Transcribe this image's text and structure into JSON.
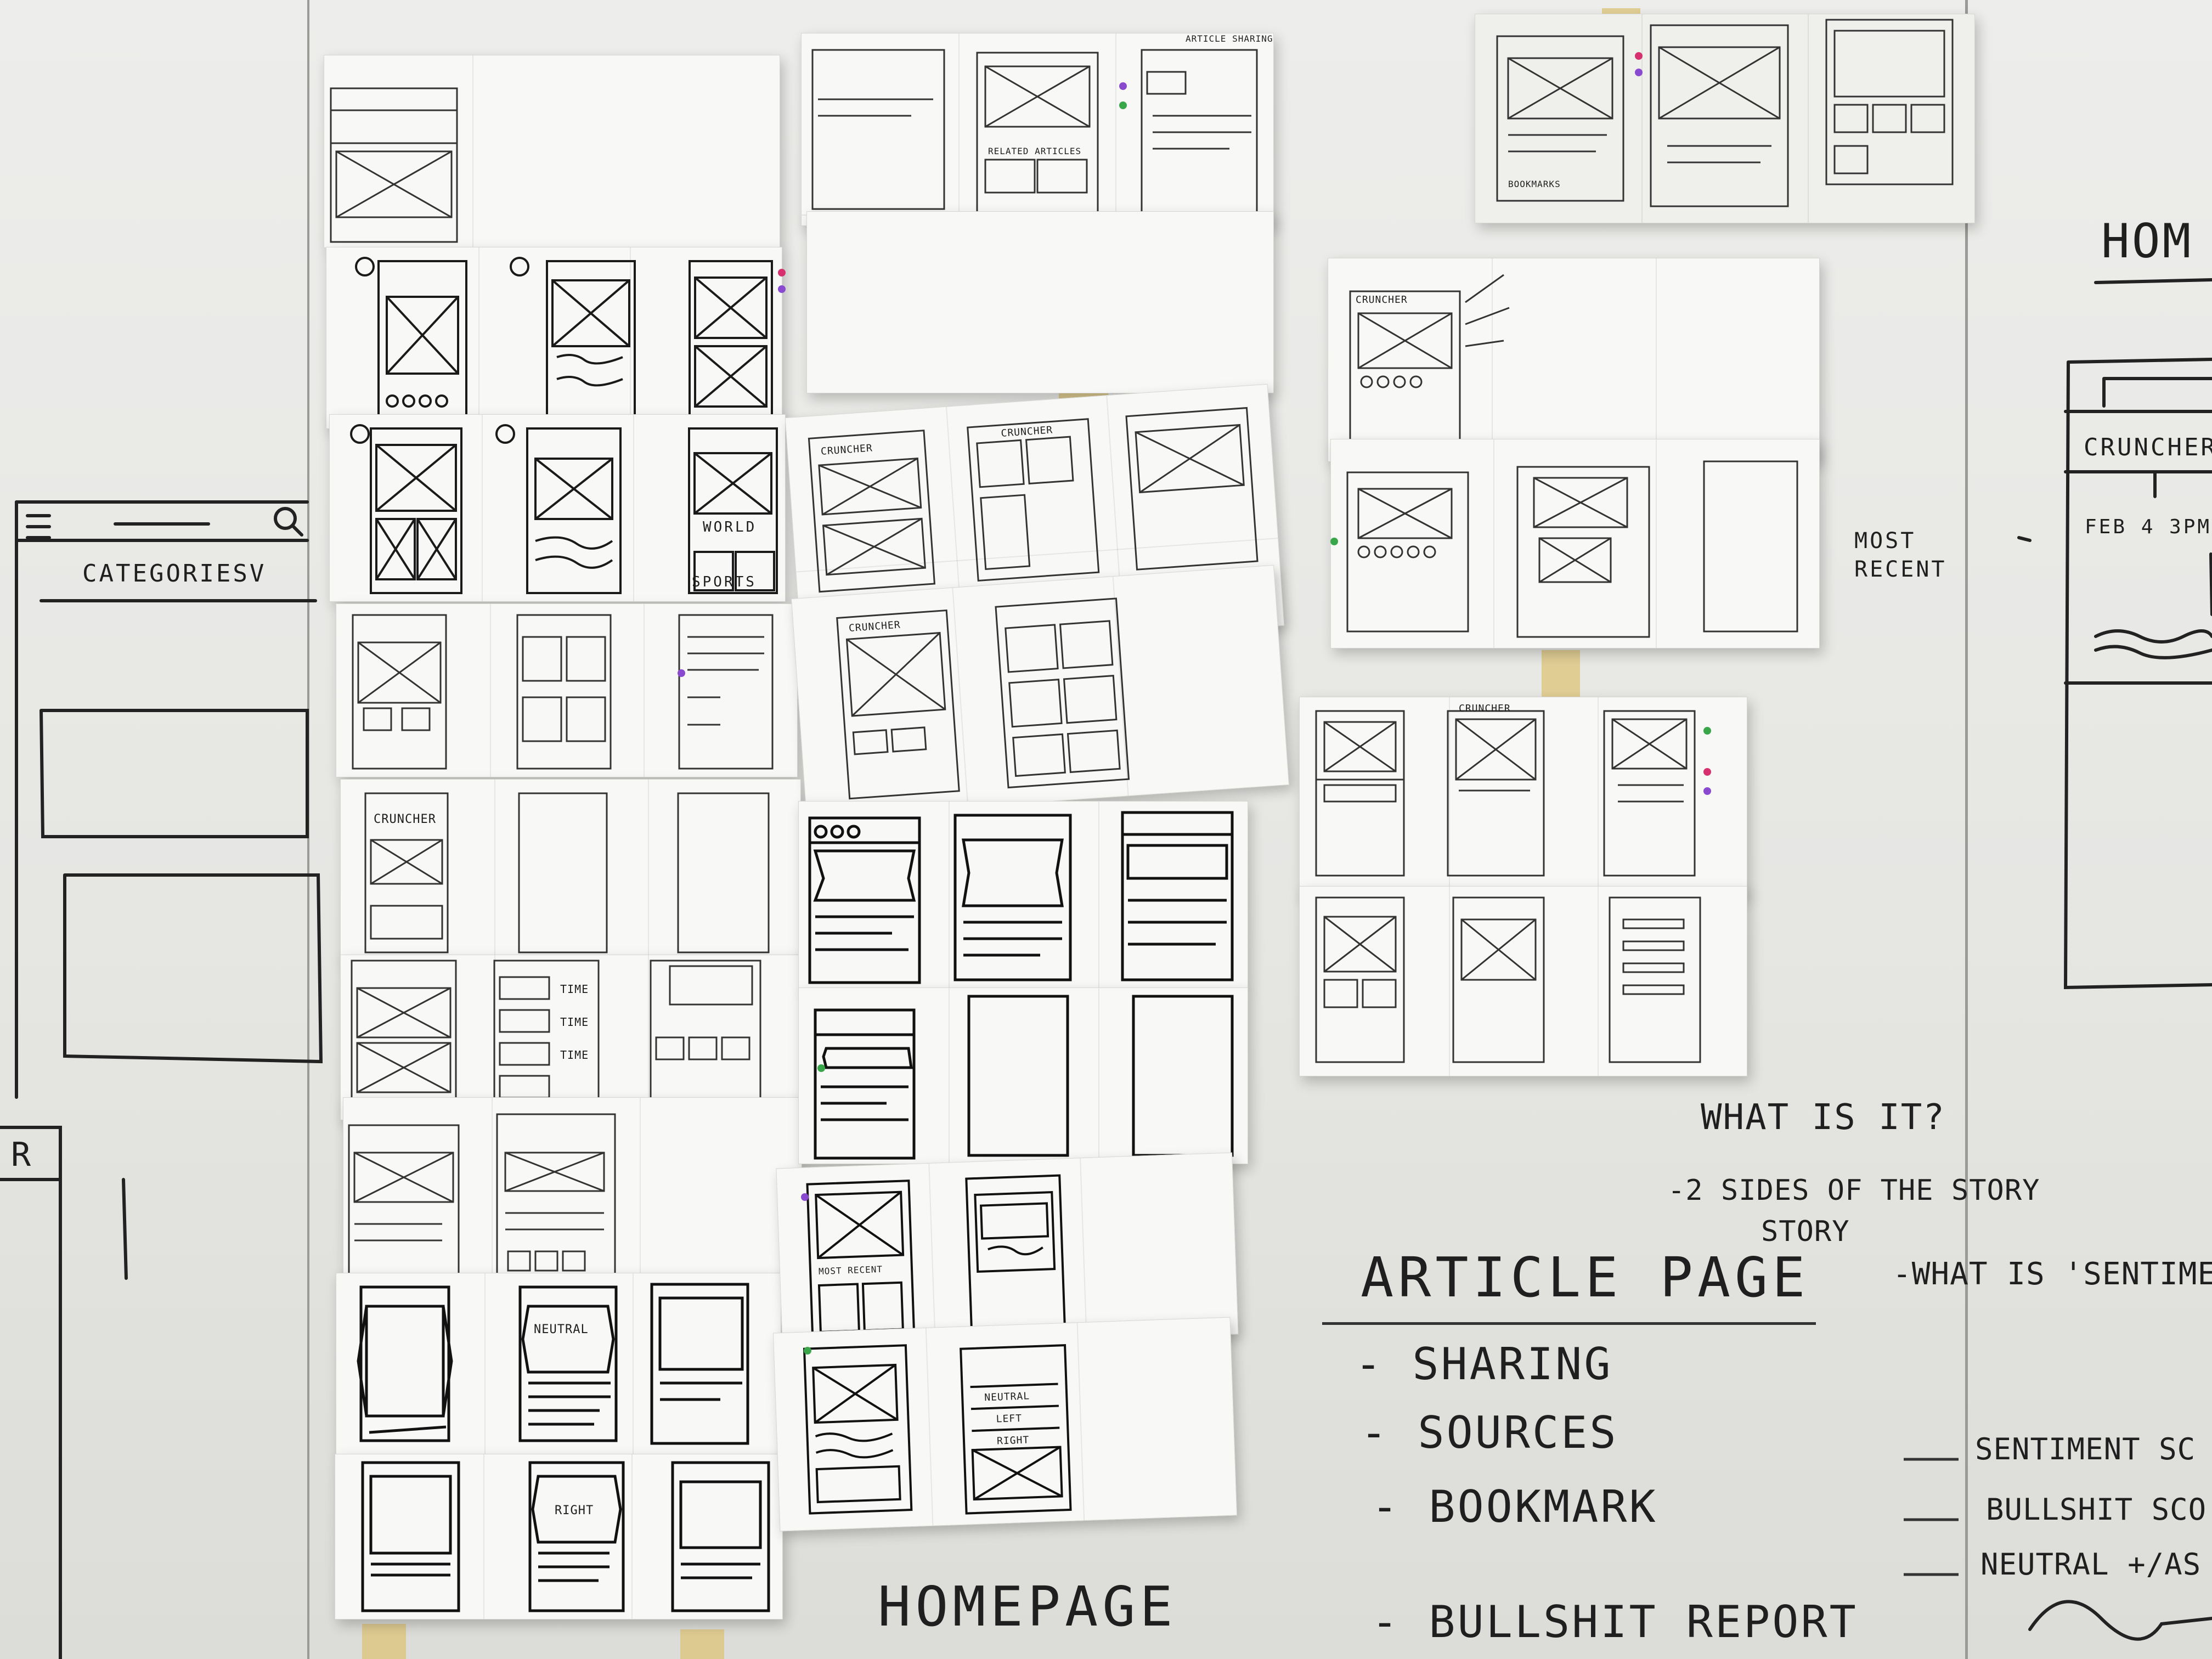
{
  "whiteboard": {
    "left": {
      "categories": "CATEGORIESV",
      "mock_r": "R"
    },
    "right": {
      "homepage_heading": "HOM",
      "cruncher": "CRUNCHER",
      "date": "FEB 4 3PM",
      "most_recent": "MOST RECENT"
    },
    "notes": {
      "what_is_it": "WHAT IS IT?",
      "two_sides": "-2 SIDES OF THE STORY",
      "what_is_sentiment": "-WHAT IS 'SENTIME",
      "article_page": "ARTICLE PAGE",
      "items": [
        "- SHARING",
        "- SOURCES",
        "- BOOKMARK",
        "- BULLSHIT REPORT"
      ],
      "scores": [
        "SENTIMENT SC",
        "BULLSHIT SCO",
        "NEUTRAL +/AS"
      ],
      "homepage": "HOMEPAGE"
    },
    "sheet_labels": {
      "cruncher_a": "CRUNCHER",
      "cruncher_b": "CRUNCHER",
      "cruncher_c": "CRUNCHER",
      "cruncher_d": "CRUNCHER",
      "cruncher_e": "CRUNCHER",
      "cruncher_f": "CRUNCHER",
      "neutral_a": "NEUTRAL",
      "neutral_b": "NEUTRAL",
      "left": "LEFT",
      "right_a": "RIGHT",
      "right_b": "RIGHT",
      "world": "WORLD",
      "sports": "SPORTS",
      "time1": "TIME",
      "time2": "TIME",
      "time3": "TIME",
      "related_articles": "RELATED ARTICLES",
      "most_recent_small": "MOST RECENT",
      "article_sharing": "ARTICLE SHARING",
      "bookmarks": "BOOKMARKS"
    },
    "colors": {
      "paper": "#f8f8f6",
      "ink": "#1f1f1f",
      "tape": "#dec478",
      "dot_pink": "#d7306f",
      "dot_purple": "#8a4ad0",
      "dot_green": "#3aa64a"
    }
  }
}
